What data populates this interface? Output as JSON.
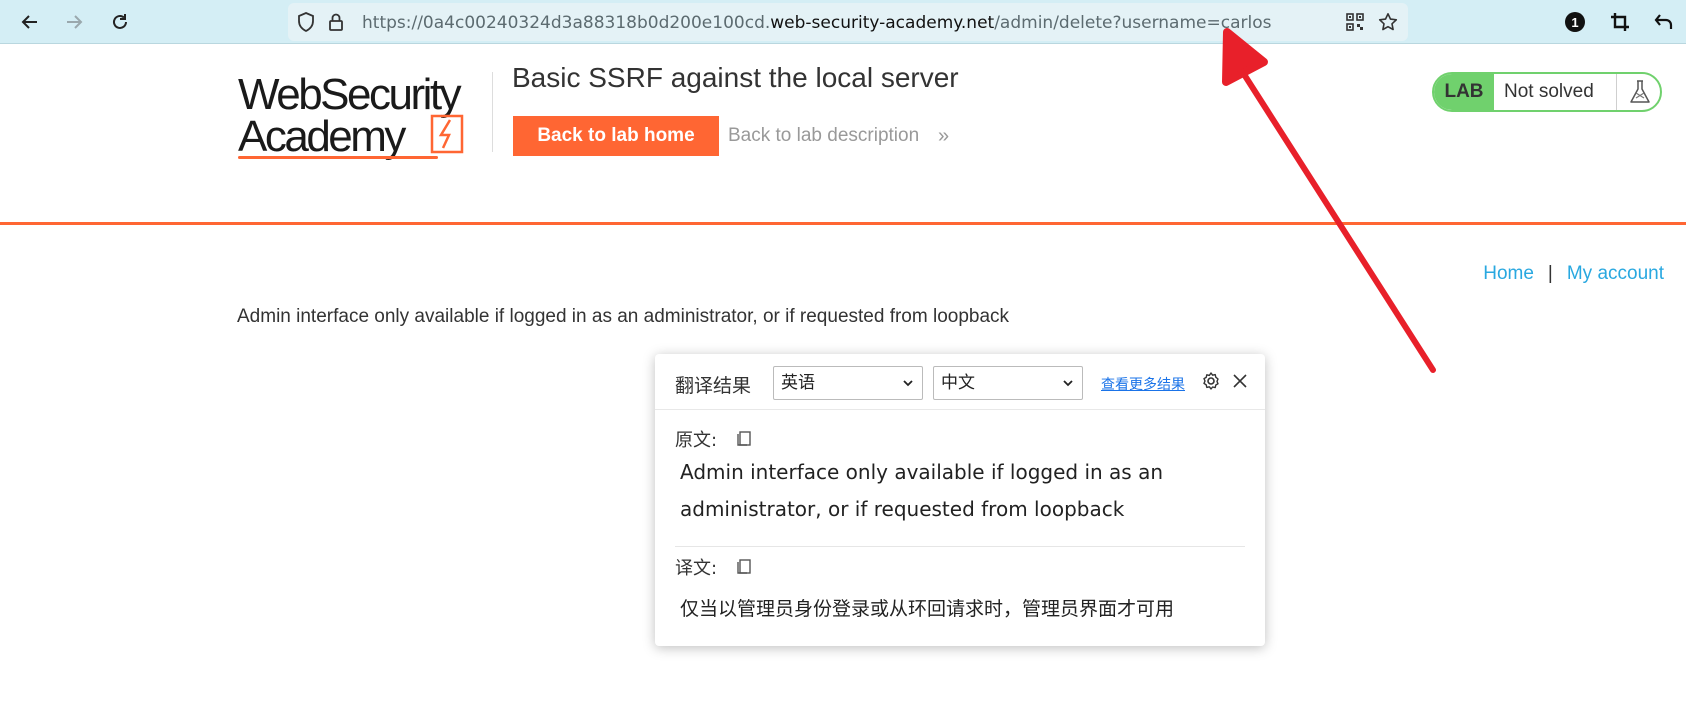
{
  "browser": {
    "url_prefix": "https://0a4c00240324d3a88318b0d200e100cd.",
    "url_domain": "web-security-academy.net",
    "url_path": "/admin/delete?username=carlos",
    "extension_badge": "1"
  },
  "header": {
    "logo_line1": "WebSecurity",
    "logo_line2": "Academy",
    "lab_title": "Basic SSRF against the local server",
    "back_home_label": "Back to lab home",
    "back_desc_label": "Back to lab description",
    "back_desc_chevron": "»",
    "lab_badge": "LAB",
    "lab_status": "Not solved"
  },
  "nav": {
    "home": "Home",
    "separator": "|",
    "my_account": "My account"
  },
  "main": {
    "message": "Admin interface only available if logged in as an administrator, or if requested from loopback"
  },
  "translate_popup": {
    "title": "翻译结果",
    "source_lang": "英语",
    "target_lang": "中文",
    "more_results": "查看更多结果",
    "source_label": "原文:",
    "source_text": "Admin interface only available if logged in as an administrator, or if requested from loopback",
    "target_label": "译文:",
    "target_text": "仅当以管理员身份登录或从环回请求时，管理员界面才可用"
  },
  "colors": {
    "accent": "#ff6633",
    "toolbar": "#d4eef5",
    "link": "#29a8e0",
    "lab_green": "#70d16d",
    "annotation_arrow": "#e8202a"
  }
}
